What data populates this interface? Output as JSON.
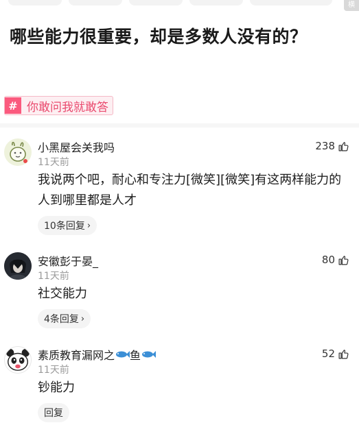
{
  "corner_tag": "横",
  "question": {
    "title": "哪些能力很重要，却是多数人没有的？",
    "topic_icon": "#",
    "topic": "你敢问我就敢答"
  },
  "comments": [
    {
      "username": "小黑屋会关我吗",
      "time": "11天前",
      "text": "我说两个吧，耐心和专注力[微笑][微笑]有这两样能力的人到哪里都是人才",
      "likes": "238",
      "reply_label": "10条回复",
      "avatar": "rabbit-doodle-avatar"
    },
    {
      "username": "安徽彭于晏_",
      "time": "11天前",
      "text": "社交能力",
      "likes": "80",
      "reply_label": "4条回复",
      "avatar": "dark-character-avatar"
    },
    {
      "username": "素质教育漏网之",
      "username_mid": "鱼",
      "time": "11天前",
      "text": "钞能力",
      "likes": "52",
      "reply_label": "回复",
      "avatar": "panda-avatar"
    }
  ],
  "icons": {
    "like": "thumbs-up-icon",
    "fish": "fish-emoji-icon",
    "chevron": "chevron-right-icon"
  }
}
